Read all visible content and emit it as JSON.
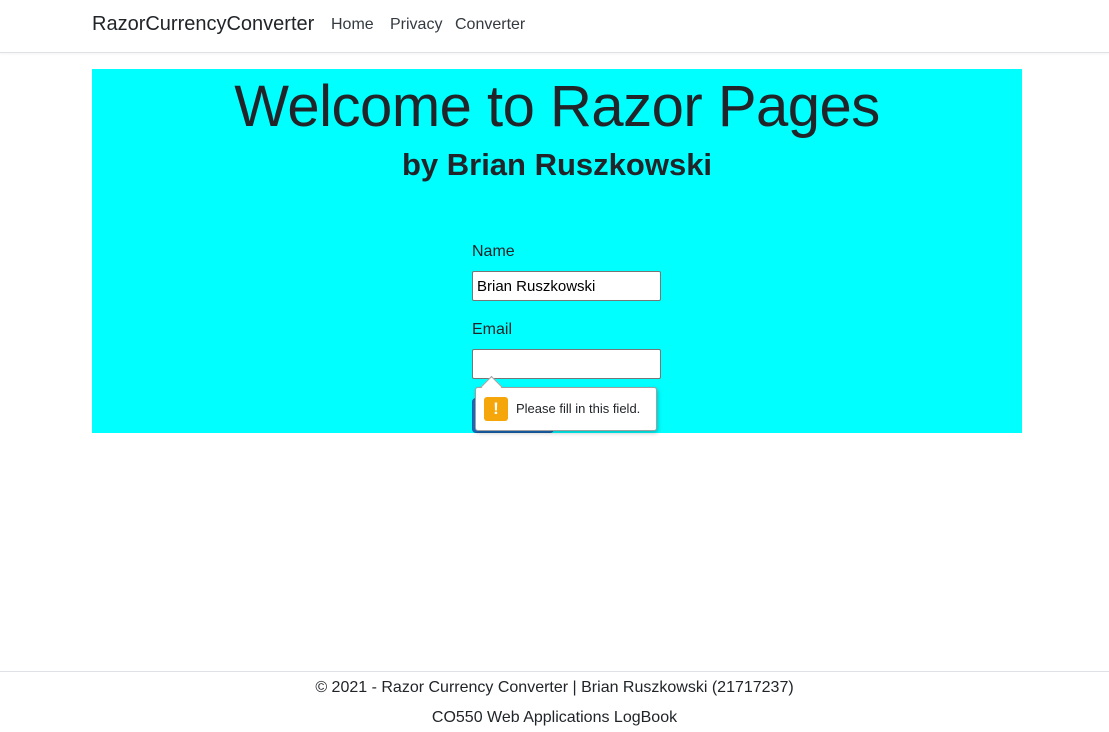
{
  "navbar": {
    "brand": "RazorCurrencyConverter",
    "links": [
      "Home",
      "Privacy",
      "Converter"
    ]
  },
  "hero": {
    "title": "Welcome to Razor Pages",
    "subtitle": "by Brian Ruszkowski",
    "background_color": "#00ffff"
  },
  "form": {
    "name_label": "Name",
    "name_value": "Brian Ruszkowski",
    "email_label": "Email",
    "email_value": "",
    "validation_message": "Please fill in this field.",
    "validation_icon": "warning-icon"
  },
  "footer": {
    "line1": "© 2021 - Razor Currency Converter | Brian Ruszkowski (21717237)",
    "line2": "CO550 Web Applications LogBook"
  }
}
